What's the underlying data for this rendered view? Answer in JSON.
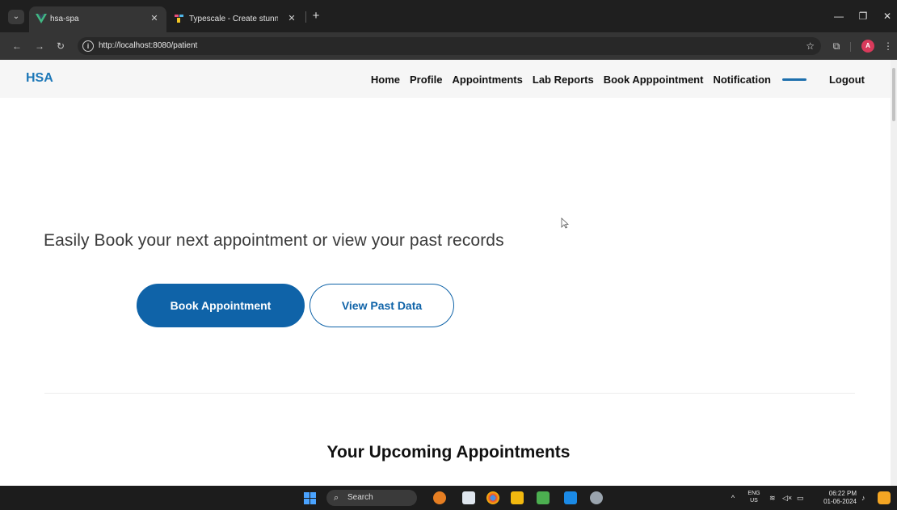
{
  "browser": {
    "tabs": [
      {
        "title": "hsa-spa",
        "icon": "vue-logo-icon",
        "active": true
      },
      {
        "title": "Typescale - Create stunning typ",
        "icon": "typescale-favicon-icon",
        "active": false
      }
    ],
    "new_tab_label": "+",
    "url": "http://localhost:8080/patient",
    "profile_initial": "A"
  },
  "app": {
    "brand": "HSA",
    "nav": {
      "home": "Home",
      "profile": "Profile",
      "appointments": "Appointments",
      "lab_reports": "Lab Reports",
      "book_appointment": "Book Apppointment",
      "notification": "Notification",
      "logout": "Logout"
    },
    "hero": {
      "text": "Easily Book your next appointment or view your past records",
      "primary_button": "Book Appointment",
      "secondary_button": "View Past Data"
    },
    "upcoming_title": "Your Upcoming Appointments"
  },
  "taskbar": {
    "search_placeholder": "Search",
    "lang_line1": "ENG",
    "lang_line2": "US",
    "time": "06:22 PM",
    "date": "01-06-2024"
  },
  "colors": {
    "brand": "#1d78b8",
    "primary_button": "#0f63a8",
    "nav_indicator": "#1d6fad"
  }
}
